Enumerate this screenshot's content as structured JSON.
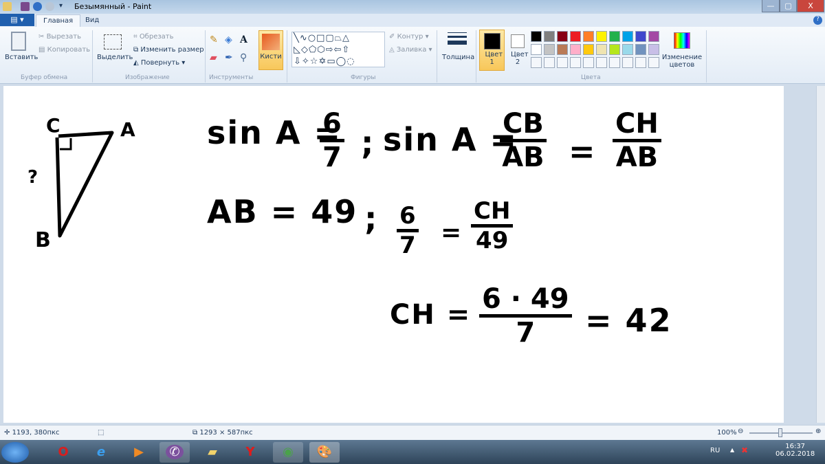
{
  "window": {
    "title": "Безымянный - Paint",
    "minimize": "—",
    "maximize": "▢",
    "close": "X"
  },
  "tabs": {
    "file": "▤ ▾",
    "home": "Главная",
    "view": "Вид"
  },
  "ribbon": {
    "clipboard": {
      "paste": "Вставить",
      "cut": "Вырезать",
      "copy": "Копировать",
      "group": "Буфер обмена"
    },
    "image": {
      "select": "Выделить",
      "crop": "Обрезать",
      "resize": "Изменить размер",
      "rotate": "Повернуть ▾",
      "group": "Изображение"
    },
    "tools": {
      "group": "Инструменты"
    },
    "brushes": {
      "label": "Кисти"
    },
    "shapes": {
      "outline": "Контур ▾",
      "fill": "Заливка ▾",
      "group": "Фигуры"
    },
    "size": {
      "label": "Толщина"
    },
    "colors": {
      "color1": "Цвет 1",
      "color2": "Цвет 2",
      "edit": "Изменение цветов",
      "group": "Цвета",
      "row1": [
        "#000000",
        "#7f7f7f",
        "#880015",
        "#ed1c24",
        "#ff7f27",
        "#fff200",
        "#22b14c",
        "#00a2e8",
        "#3f48cc",
        "#a349a4"
      ],
      "row2": [
        "#ffffff",
        "#c3c3c3",
        "#b97a57",
        "#ffaec9",
        "#ffc90e",
        "#efe4b0",
        "#b5e61d",
        "#99d9ea",
        "#7092be",
        "#c8bfe7"
      ]
    }
  },
  "drawing": {
    "vertex_c": "C",
    "vertex_a": "A",
    "vertex_b": "B",
    "unknown": "?",
    "line1_a": "sin A =",
    "f1_num": "6",
    "f1_den": "7",
    "sep1": ";",
    "line1_b": "sin A =",
    "f2_num": "CB",
    "f2_den": "AB",
    "eq1": "=",
    "f3_num": "CH",
    "f3_den": "AB",
    "line2_a": "AB = 49",
    "sep2": ";",
    "f4_num": "6",
    "f4_den": "7",
    "eq2": "=",
    "f5_num": "CH",
    "f5_den": "49",
    "line3_a": "CH =",
    "f6_num": "6 · 49",
    "f6_den": "7",
    "line3_b": "= 42"
  },
  "status": {
    "cursor": "1193, 380пкс",
    "selection": "",
    "canvas_size": "1293 × 587пкс",
    "zoom": "100%"
  },
  "taskbar": {
    "lang": "RU",
    "time": "16:37",
    "date": "06.02.2018"
  }
}
